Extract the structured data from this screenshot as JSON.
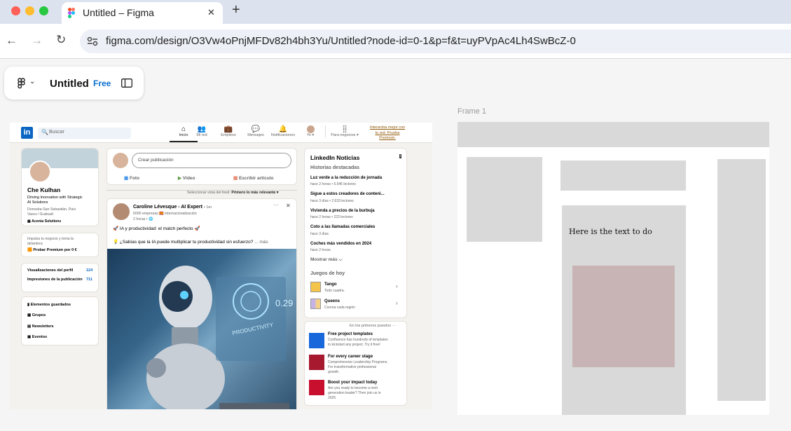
{
  "browser": {
    "tab_title": "Untitled – Figma",
    "new_tab": "+",
    "close": "✕",
    "url": "figma.com/design/O3Vw4oPnjMFDv82h4bh3Yu/Untitled?node-id=0-1&p=f&t=uyPVpAc4Lh4SwBcZ-0"
  },
  "figma": {
    "file_name": "Untitled",
    "plan_badge": "Free",
    "frame_label": "Frame 1",
    "frame_text": "Here is the text to do"
  },
  "linkedin": {
    "search_placeholder": "Buscar",
    "nav": [
      "Inicio",
      "Mi red",
      "Empleos",
      "Mensajes",
      "Notificaciones",
      "Yo ▾",
      "Para negocios ▾"
    ],
    "premium_promo": [
      "Interactúa mejor con",
      "tu red. Prueba",
      "Premium."
    ],
    "profile": {
      "name": "Che Kulhan",
      "headline": [
        "Driving Innovation with Strategic",
        "AI Solutions"
      ],
      "location": [
        "Donostia-San Sebastián, País",
        "Vasco / Euskadi"
      ],
      "company": "Acenia Solutions",
      "promo": [
        "Impulsa tu negocio y toma la",
        "delantera"
      ],
      "premium_cta": "Probar Premium por 0 €",
      "stats": [
        {
          "label": "Visualizaciones del perfil",
          "value": "124"
        },
        {
          "label": "Impresiones de la publicación",
          "value": "711"
        }
      ],
      "links": [
        "Elementos guardados",
        "Grupos",
        "Newsletters",
        "Eventos"
      ]
    },
    "composer": {
      "placeholder": "Crear publicación",
      "actions": [
        "Foto",
        "Vídeo",
        "Escribir artículo"
      ],
      "sort_label": "Seleccionar vista del feed:",
      "sort_value": "Primero lo más relevante ▾"
    },
    "post": {
      "author": "Caroline Lévesque - AI Expert",
      "degree": "• 1er",
      "meta": "6000 empresas 🇪🇸 internacionalización",
      "time": "2 horas • 🌐",
      "line1": "🚀 IA y productividad: el match perfecto 🚀",
      "line2": "💡 ¿Sabías que la IA puede multiplicar tu productividad sin esfuerzo?",
      "more": "... más",
      "menu": "···",
      "close": "✕",
      "image_text_1": "0.29",
      "image_text_2": "PRODUCTIVITY"
    },
    "news": {
      "title": "LinkedIn Noticias",
      "subtitle": "Historias destacadas",
      "items": [
        {
          "title": "Luz verde a la reducción de jornada",
          "meta": "hace 2 horas • 5.646 lectores"
        },
        {
          "title": "Sigue a estos creadores de conteni...",
          "meta": "hace 3 días • 2.633 lectores"
        },
        {
          "title": "Vivienda a precios de la burbuja",
          "meta": "hace 2 horas • 223 lectores"
        },
        {
          "title": "Coto a las llamadas comerciales",
          "meta": "hace 3 días"
        },
        {
          "title": "Coches más vendidos en 2024",
          "meta": "hace 2 horas"
        }
      ],
      "show_more": "Mostrar más ⌵",
      "games_title": "Juegos de hoy",
      "games": [
        {
          "name": "Tango",
          "sub": "Todo cuadra."
        },
        {
          "name": "Queens",
          "sub": "Corona cada región"
        }
      ]
    },
    "ads": {
      "header": "En los primeros puestos ···",
      "items": [
        {
          "title": "Free project templates",
          "body": [
            "Confluence has hundreds of templates",
            "to kickstart any project. Try it free!"
          ]
        },
        {
          "title": "For every career stage",
          "body": [
            "Comprehensive Leadership Programs.",
            "For transformative professional",
            "growth."
          ]
        },
        {
          "title": "Boost your impact today",
          "body": [
            "Are you ready to become a next",
            "generation leader? Then join us in",
            "2025"
          ]
        }
      ]
    }
  }
}
